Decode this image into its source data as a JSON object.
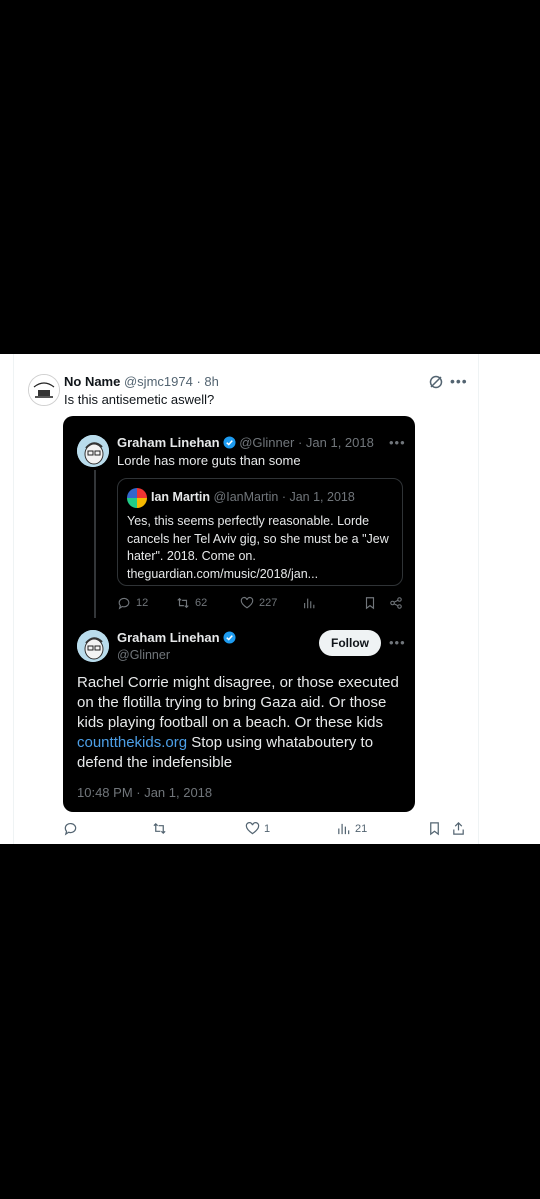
{
  "outer_tweet": {
    "author_name": "No Name",
    "handle": "@sjmc1974",
    "separator": "·",
    "time": "8h",
    "text": "Is this antisemetic aswell?",
    "actions": {
      "replies": "",
      "retweets": "",
      "likes": "1",
      "views": "21"
    }
  },
  "quoted_tweet": {
    "author_name": "Graham Linehan",
    "handle": "@Glinner",
    "date": "Jan 1, 2018",
    "separator": "·",
    "text": "Lorde has more guts than some",
    "nested": {
      "author_name": "Ian Martin",
      "handle": "@IanMartin",
      "date": "Jan 1, 2018",
      "text": "Yes, this seems perfectly reasonable. Lorde cancels her Tel Aviv gig, so she must be a \"Jew hater\". 2018. Come on. theguardian.com/music/2018/jan..."
    },
    "actions": {
      "replies": "12",
      "retweets": "62",
      "likes": "227"
    }
  },
  "reply_tweet": {
    "author_name": "Graham Linehan",
    "handle": "@Glinner",
    "follow_label": "Follow",
    "text_before_link": "Rachel Corrie might disagree, or those executed on the flotilla trying to bring Gaza aid. Or those kids playing football on a beach. Or these kids ",
    "link_text": "countthekids.org",
    "text_after_link": " Stop using whataboutery to defend the indefensible",
    "timestamp": "10:48 PM · Jan 1, 2018"
  },
  "colors": {
    "background": "#000000",
    "card": "#ffffff",
    "verified": "#1d9bf0",
    "link": "#4d9fe6",
    "muted": "#71767b"
  }
}
